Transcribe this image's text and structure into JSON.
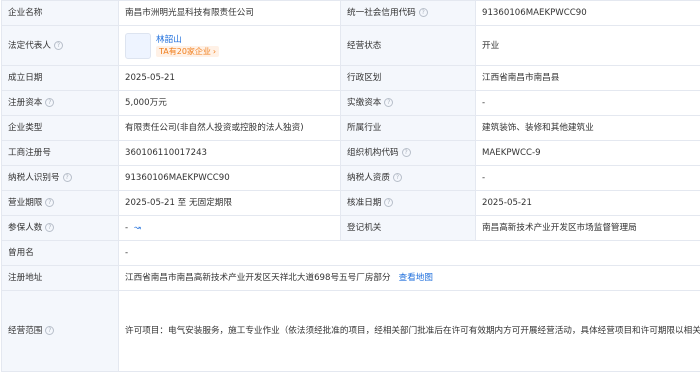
{
  "rows": {
    "r1": {
      "l1": "企业名称",
      "v1": "南昌市洲明光显科技有限责任公司",
      "l2": "统一社会信用代码",
      "v2": "91360106MAEKPWCC90"
    },
    "r2": {
      "l1": "法定代表人",
      "rep_name": "林韶山",
      "rep_badge": "TA有20家企业",
      "rep_badge_arrow": "›",
      "l2": "经营状态",
      "v2": "开业"
    },
    "r3": {
      "l1": "成立日期",
      "v1": "2025-05-21",
      "l2": "行政区划",
      "v2": "江西省南昌市南昌县"
    },
    "r4": {
      "l1": "注册资本",
      "v1": "5,000万元",
      "l2": "实缴资本",
      "v2": "-"
    },
    "r5": {
      "l1": "企业类型",
      "v1": "有限责任公司(非自然人投资或控股的法人独资)",
      "l2": "所属行业",
      "v2": "建筑装饰、装修和其他建筑业"
    },
    "r6": {
      "l1": "工商注册号",
      "v1": "360106110017243",
      "l2": "组织机构代码",
      "v2": "MAEKPWCC-9"
    },
    "r7": {
      "l1": "纳税人识别号",
      "v1": "91360106MAEKPWCC90",
      "l2": "纳税人资质",
      "v2": "-"
    },
    "r8": {
      "l1": "营业期限",
      "v1": "2025-05-21 至 无固定期限",
      "l2": "核准日期",
      "v2": "2025-05-21"
    },
    "r9": {
      "l1": "参保人数",
      "v1": "-",
      "l2": "登记机关",
      "v2": "南昌高新技术产业开发区市场监督管理局"
    },
    "r10": {
      "l1": "曾用名",
      "v1": "-"
    },
    "r11": {
      "l1": "注册地址",
      "v1": "江西省南昌市南昌高新技术产业开发区天祥北大道698号五号厂房部分",
      "link": "查看地图"
    },
    "r12": {
      "l1": "经营范围",
      "v1": "许可项目：电气安装服务，施工专业作业（依法须经批准的项目，经相关部门批准后在许可有效期内方可开展经营活动，具体经营项目和许可期限以相关部门批准文件或许可证件为准）一般项目：技术服务、技术开发、技术咨询、技术交流、技术转让、技术推广，显示器件制造，显示器件销售，半导体照明器件制造，半导体照明器件销售，其他电子器件制造，电子元器件制造，照明器具制造，半导体器件专用设备制造，电子元器件零售，电子元器件批发，智能控制系统集成，灯具销售，照明器具销售，照明器具生产专用设备制造，照明器具生产专用设备销售，合同能源管理，节能管理服务，工业设计服务，国内贸易代理（除依法须经批准的项目外，凭营业执照依法自主开展经营活动）"
    }
  },
  "icons": {
    "help": "question-circle-icon",
    "trend": "chart-line-icon"
  },
  "colors": {
    "label_bg": "#f4f7fc",
    "border": "#e4e8f0",
    "link": "#1f6fdc",
    "badge_text": "#f07d1a",
    "badge_bg": "#fff1e6"
  }
}
